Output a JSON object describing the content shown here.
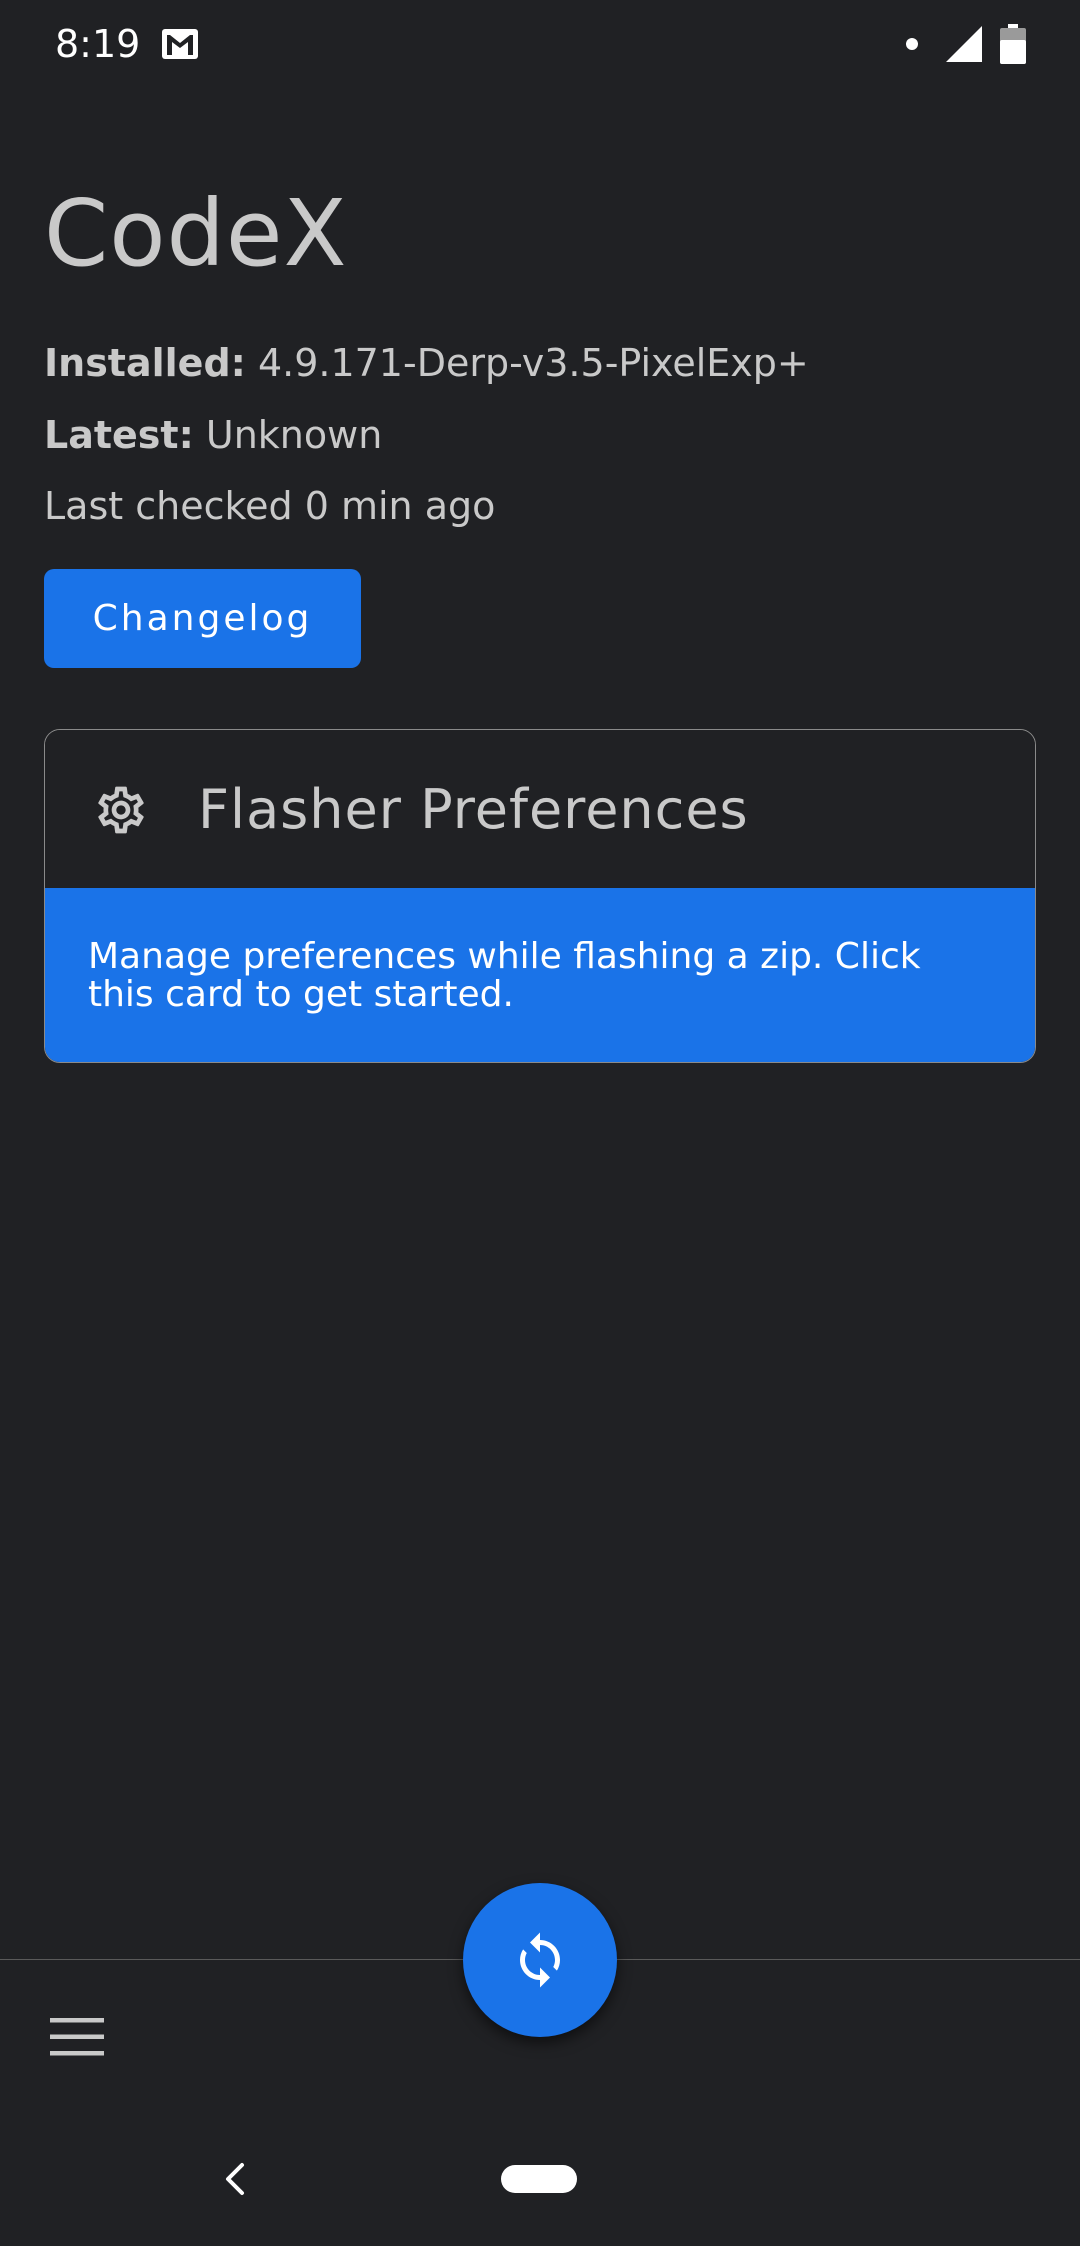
{
  "status_bar": {
    "time": "8:19",
    "icons": [
      "gmail-icon",
      "notification-dot-icon",
      "cell-signal-icon",
      "battery-icon"
    ]
  },
  "app": {
    "title": "CodeX"
  },
  "info": {
    "installed_label": "Installed:",
    "installed_value": "4.9.171-Derp-v3.5-PixelExp+",
    "latest_label": "Latest:",
    "latest_value": "Unknown",
    "last_checked": "Last checked 0 min ago"
  },
  "changelog_button": {
    "label": "Changelog"
  },
  "flasher_card": {
    "icon": "gear-icon",
    "title": "Flasher Preferences",
    "description": "Manage preferences while flashing a zip. Click this card to get started."
  },
  "bottom_bar": {
    "menu_icon": "menu-icon",
    "fab_icon": "refresh-icon"
  },
  "nav_bar": {
    "back_icon": "back-icon",
    "home_icon": "home-pill-icon"
  },
  "colors": {
    "background": "#202124",
    "accent": "#1a73e8",
    "text": "#c9c9c9",
    "white": "#ffffff"
  }
}
